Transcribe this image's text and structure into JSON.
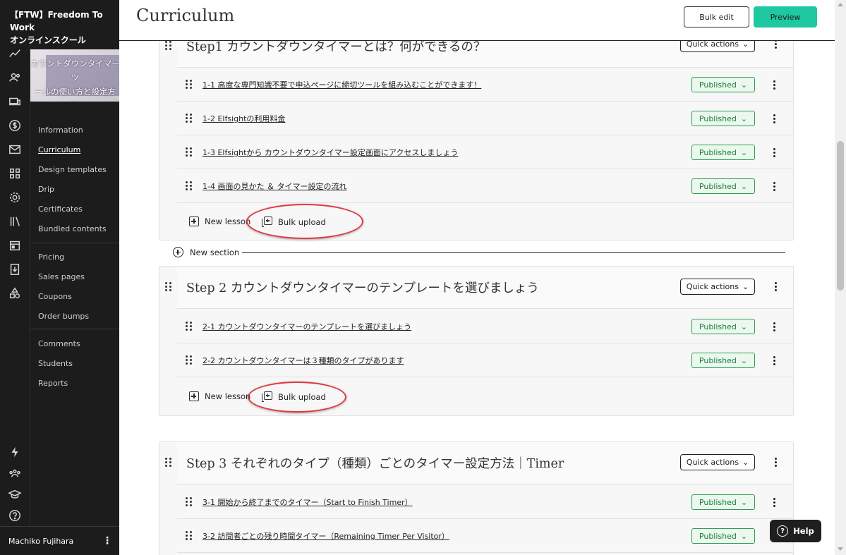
{
  "school": {
    "name_line1": "【FTW】Freedom To Work",
    "name_line2": "オンラインスクール"
  },
  "course": {
    "thumbnail_caption_1": "カウントダウンタイマーツ",
    "thumbnail_caption_2": "ールの使い方と設定方",
    "thumbnail_caption_3": "法"
  },
  "rail_icons": [
    "analytics-icon",
    "users-icon",
    "devices-icon",
    "dollar-icon",
    "mail-icon",
    "apps-icon",
    "settings-icon",
    "library-icon",
    "calendar-icon",
    "download-icon",
    "shapes-icon",
    "lightning-icon",
    "community-icon",
    "graduation-icon",
    "help-icon"
  ],
  "sidebar": {
    "group1": [
      "Information",
      "Curriculum",
      "Design templates",
      "Drip",
      "Certificates",
      "Bundled contents"
    ],
    "group2": [
      "Pricing",
      "Sales pages",
      "Coupons",
      "Order bumps"
    ],
    "group3": [
      "Comments",
      "Students",
      "Reports"
    ],
    "active": "Curriculum"
  },
  "user": {
    "name": "Machiko Fujihara",
    "menu": "⋮"
  },
  "header": {
    "title": "Curriculum",
    "bulk_edit": "Bulk edit",
    "preview": "Preview"
  },
  "labels": {
    "quick_actions": "Quick actions",
    "published": "Published",
    "new_lesson": "New lesson",
    "bulk_upload": "Bulk upload",
    "new_section": "New section",
    "help": "Help"
  },
  "sections": [
    {
      "title": "Step1 カウントダウンタイマーとは？何ができるの？",
      "lessons": [
        "1-1 高度な専門知識不要で申込ページに締切ツールを組み込むことができます！",
        "1-2 Elfsightの利用料金",
        "1-3 Elfsightから カウントダウンタイマー設定画面にアクセスしましょう",
        "1-4 画面の見かた ＆ タイマー設定の流れ"
      ]
    },
    {
      "title": "Step 2 カウントダウンタイマーのテンプレートを選びましょう",
      "lessons": [
        "2-1 カウントダウンタイマーのテンプレートを選びましょう",
        "2-2 カウントダウンタイマーは３種類のタイプがあります"
      ]
    },
    {
      "title": "Step 3 それぞれのタイプ（種類）ごとのタイマー設定方法｜Timer",
      "lessons": [
        "3-1 開始から終了までのタイマー（Start to Finish Timer）",
        "3-2 訪問者ごとの残り時間タイマー（Remaining Timer Per Visitor）"
      ]
    }
  ],
  "colors": {
    "accent": "#1ec8a0",
    "published_border": "#2e9c55",
    "annotation": "#e0383e",
    "sidebar_bg": "#1c1c1c"
  }
}
